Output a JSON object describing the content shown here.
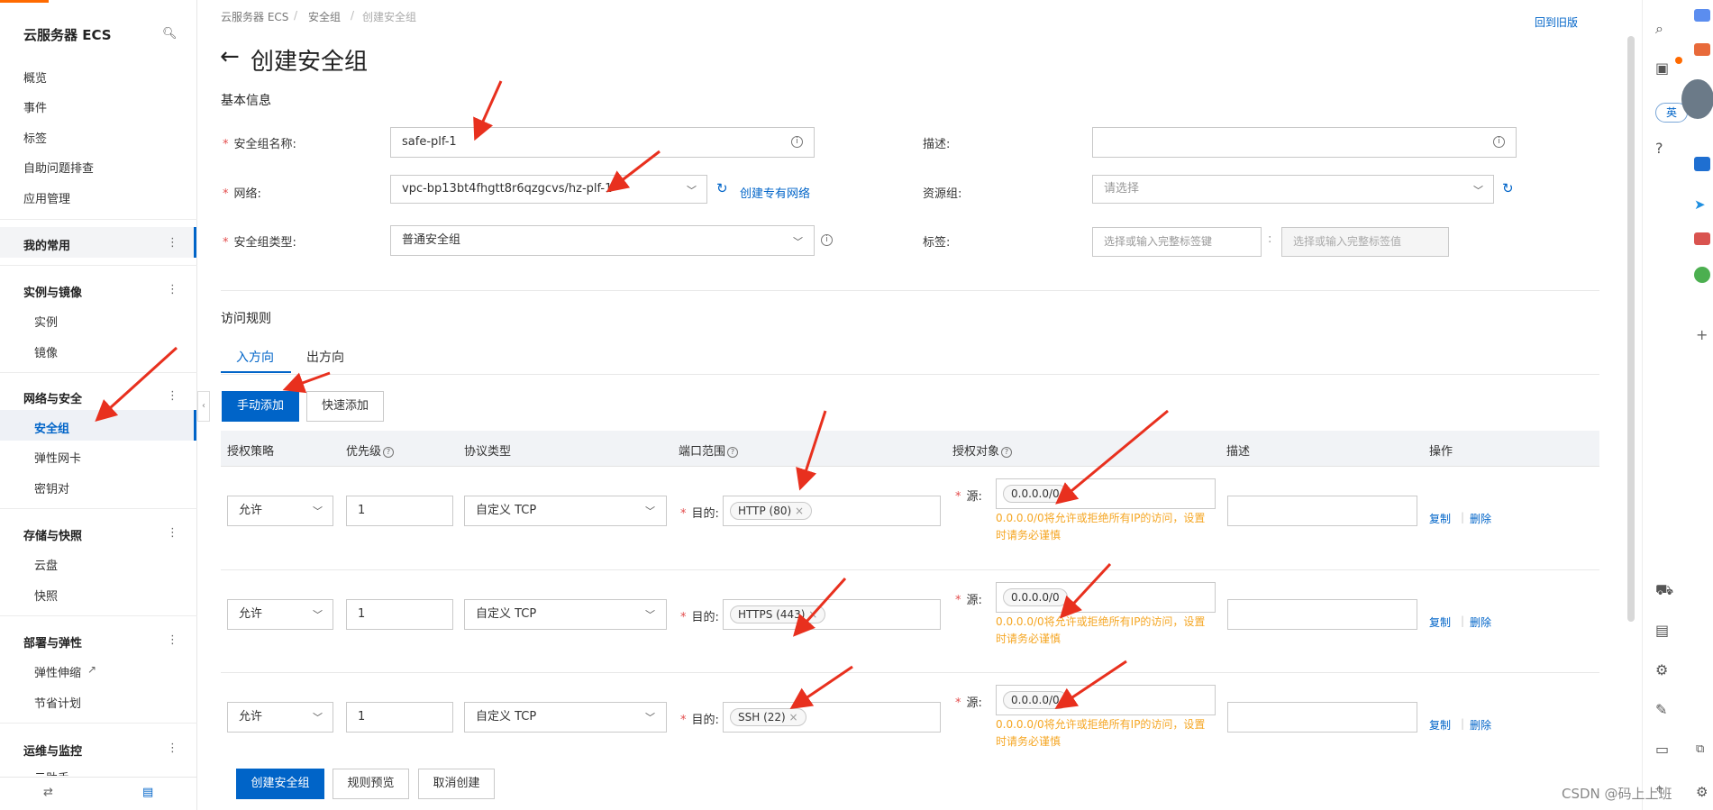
{
  "sidebar": {
    "title": "云服务器 ECS",
    "items": [
      "概览",
      "事件",
      "标签",
      "自助问题排查",
      "应用管理"
    ],
    "favorites": "我的常用",
    "groups": [
      {
        "label": "实例与镜像",
        "children": [
          "实例",
          "镜像"
        ]
      },
      {
        "label": "网络与安全",
        "children": [
          "安全组",
          "弹性网卡",
          "密钥对"
        ]
      },
      {
        "label": "存储与快照",
        "children": [
          "云盘",
          "快照"
        ]
      },
      {
        "label": "部署与弹性",
        "children": [
          "弹性伸缩",
          "节省计划"
        ]
      },
      {
        "label": "运维与监控",
        "children": [
          "云助手"
        ]
      }
    ]
  },
  "breadcrumb": [
    "云服务器 ECS",
    "安全组",
    "创建安全组"
  ],
  "back_old": "回到旧版",
  "page_title": "创建安全组",
  "basic_info": {
    "section": "基本信息",
    "name_label": "安全组名称:",
    "name_value": "safe-plf-1",
    "network_label": "网络:",
    "network_value": "vpc-bp13bt4fhgtt8r6qzgcvs/hz-plf-1",
    "create_vpc_link": "创建专有网络",
    "type_label": "安全组类型:",
    "type_value": "普通安全组",
    "desc_label": "描述:",
    "resgroup_label": "资源组:",
    "resgroup_placeholder": "请选择",
    "tags_label": "标签:",
    "tag_key_placeholder": "选择或输入完整标签键",
    "tag_value_placeholder": "选择或输入完整标签值"
  },
  "access_rules": {
    "section": "访问规则",
    "tabs": [
      "入方向",
      "出方向"
    ],
    "manual_add": "手动添加",
    "quick_add": "快速添加",
    "columns": [
      "授权策略",
      "优先级",
      "协议类型",
      "端口范围",
      "授权对象",
      "描述",
      "操作"
    ],
    "dest_label": "目的:",
    "source_label": "源:",
    "warning_line1": "0.0.0.0/0将允许或拒绝所有IP的访问，设置",
    "warning_line2": "时请务必谨慎",
    "copy": "复制",
    "delete": "删除",
    "rows": [
      {
        "policy": "允许",
        "priority": "1",
        "protocol": "自定义 TCP",
        "port": "HTTP (80)",
        "source": "0.0.0.0/0"
      },
      {
        "policy": "允许",
        "priority": "1",
        "protocol": "自定义 TCP",
        "port": "HTTPS (443)",
        "source": "0.0.0.0/0"
      },
      {
        "policy": "允许",
        "priority": "1",
        "protocol": "自定义 TCP",
        "port": "SSH (22)",
        "source": "0.0.0.0/0"
      }
    ]
  },
  "footer": {
    "create": "创建安全组",
    "preview": "规则预览",
    "cancel": "取消创建"
  },
  "rightbar": {
    "lang": "英"
  },
  "watermark": "CSDN @码上上班"
}
